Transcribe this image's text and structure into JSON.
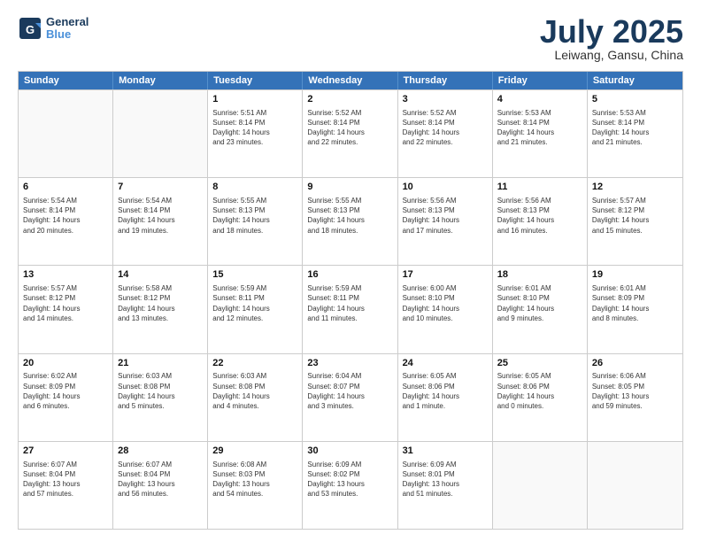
{
  "header": {
    "logo_line1": "General",
    "logo_line2": "Blue",
    "month_year": "July 2025",
    "location": "Leiwang, Gansu, China"
  },
  "weekdays": [
    "Sunday",
    "Monday",
    "Tuesday",
    "Wednesday",
    "Thursday",
    "Friday",
    "Saturday"
  ],
  "rows": [
    [
      {
        "day": "",
        "text": ""
      },
      {
        "day": "",
        "text": ""
      },
      {
        "day": "1",
        "text": "Sunrise: 5:51 AM\nSunset: 8:14 PM\nDaylight: 14 hours\nand 23 minutes."
      },
      {
        "day": "2",
        "text": "Sunrise: 5:52 AM\nSunset: 8:14 PM\nDaylight: 14 hours\nand 22 minutes."
      },
      {
        "day": "3",
        "text": "Sunrise: 5:52 AM\nSunset: 8:14 PM\nDaylight: 14 hours\nand 22 minutes."
      },
      {
        "day": "4",
        "text": "Sunrise: 5:53 AM\nSunset: 8:14 PM\nDaylight: 14 hours\nand 21 minutes."
      },
      {
        "day": "5",
        "text": "Sunrise: 5:53 AM\nSunset: 8:14 PM\nDaylight: 14 hours\nand 21 minutes."
      }
    ],
    [
      {
        "day": "6",
        "text": "Sunrise: 5:54 AM\nSunset: 8:14 PM\nDaylight: 14 hours\nand 20 minutes."
      },
      {
        "day": "7",
        "text": "Sunrise: 5:54 AM\nSunset: 8:14 PM\nDaylight: 14 hours\nand 19 minutes."
      },
      {
        "day": "8",
        "text": "Sunrise: 5:55 AM\nSunset: 8:13 PM\nDaylight: 14 hours\nand 18 minutes."
      },
      {
        "day": "9",
        "text": "Sunrise: 5:55 AM\nSunset: 8:13 PM\nDaylight: 14 hours\nand 18 minutes."
      },
      {
        "day": "10",
        "text": "Sunrise: 5:56 AM\nSunset: 8:13 PM\nDaylight: 14 hours\nand 17 minutes."
      },
      {
        "day": "11",
        "text": "Sunrise: 5:56 AM\nSunset: 8:13 PM\nDaylight: 14 hours\nand 16 minutes."
      },
      {
        "day": "12",
        "text": "Sunrise: 5:57 AM\nSunset: 8:12 PM\nDaylight: 14 hours\nand 15 minutes."
      }
    ],
    [
      {
        "day": "13",
        "text": "Sunrise: 5:57 AM\nSunset: 8:12 PM\nDaylight: 14 hours\nand 14 minutes."
      },
      {
        "day": "14",
        "text": "Sunrise: 5:58 AM\nSunset: 8:12 PM\nDaylight: 14 hours\nand 13 minutes."
      },
      {
        "day": "15",
        "text": "Sunrise: 5:59 AM\nSunset: 8:11 PM\nDaylight: 14 hours\nand 12 minutes."
      },
      {
        "day": "16",
        "text": "Sunrise: 5:59 AM\nSunset: 8:11 PM\nDaylight: 14 hours\nand 11 minutes."
      },
      {
        "day": "17",
        "text": "Sunrise: 6:00 AM\nSunset: 8:10 PM\nDaylight: 14 hours\nand 10 minutes."
      },
      {
        "day": "18",
        "text": "Sunrise: 6:01 AM\nSunset: 8:10 PM\nDaylight: 14 hours\nand 9 minutes."
      },
      {
        "day": "19",
        "text": "Sunrise: 6:01 AM\nSunset: 8:09 PM\nDaylight: 14 hours\nand 8 minutes."
      }
    ],
    [
      {
        "day": "20",
        "text": "Sunrise: 6:02 AM\nSunset: 8:09 PM\nDaylight: 14 hours\nand 6 minutes."
      },
      {
        "day": "21",
        "text": "Sunrise: 6:03 AM\nSunset: 8:08 PM\nDaylight: 14 hours\nand 5 minutes."
      },
      {
        "day": "22",
        "text": "Sunrise: 6:03 AM\nSunset: 8:08 PM\nDaylight: 14 hours\nand 4 minutes."
      },
      {
        "day": "23",
        "text": "Sunrise: 6:04 AM\nSunset: 8:07 PM\nDaylight: 14 hours\nand 3 minutes."
      },
      {
        "day": "24",
        "text": "Sunrise: 6:05 AM\nSunset: 8:06 PM\nDaylight: 14 hours\nand 1 minute."
      },
      {
        "day": "25",
        "text": "Sunrise: 6:05 AM\nSunset: 8:06 PM\nDaylight: 14 hours\nand 0 minutes."
      },
      {
        "day": "26",
        "text": "Sunrise: 6:06 AM\nSunset: 8:05 PM\nDaylight: 13 hours\nand 59 minutes."
      }
    ],
    [
      {
        "day": "27",
        "text": "Sunrise: 6:07 AM\nSunset: 8:04 PM\nDaylight: 13 hours\nand 57 minutes."
      },
      {
        "day": "28",
        "text": "Sunrise: 6:07 AM\nSunset: 8:04 PM\nDaylight: 13 hours\nand 56 minutes."
      },
      {
        "day": "29",
        "text": "Sunrise: 6:08 AM\nSunset: 8:03 PM\nDaylight: 13 hours\nand 54 minutes."
      },
      {
        "day": "30",
        "text": "Sunrise: 6:09 AM\nSunset: 8:02 PM\nDaylight: 13 hours\nand 53 minutes."
      },
      {
        "day": "31",
        "text": "Sunrise: 6:09 AM\nSunset: 8:01 PM\nDaylight: 13 hours\nand 51 minutes."
      },
      {
        "day": "",
        "text": ""
      },
      {
        "day": "",
        "text": ""
      }
    ]
  ]
}
